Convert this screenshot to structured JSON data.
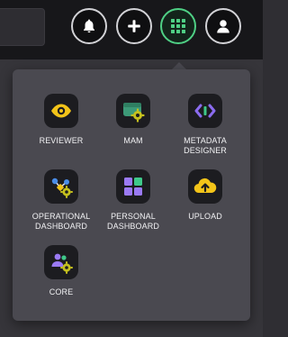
{
  "header": {
    "buttons": [
      {
        "icon": "bell-icon"
      },
      {
        "icon": "plus-icon"
      },
      {
        "icon": "grid-icon",
        "active": true
      },
      {
        "icon": "user-icon"
      }
    ],
    "accent_color": "#4fd085"
  },
  "apps_menu": {
    "items": [
      {
        "label": "REVIEWER",
        "icon": "eye-icon"
      },
      {
        "label": "MAM",
        "icon": "media-gear-icon"
      },
      {
        "label": "METADATA\nDESIGNER",
        "icon": "code-brackets-icon"
      },
      {
        "label": "OPERATIONAL\nDASHBOARD",
        "icon": "workflow-gear-icon"
      },
      {
        "label": "PERSONAL\nDASHBOARD",
        "icon": "dashboard-tiles-icon"
      },
      {
        "label": "UPLOAD",
        "icon": "cloud-upload-icon"
      },
      {
        "label": "CORE",
        "icon": "users-gear-icon"
      }
    ]
  }
}
